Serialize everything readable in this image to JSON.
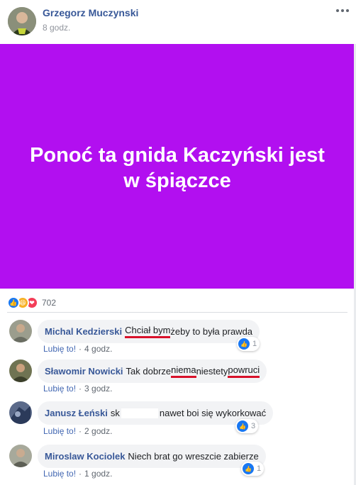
{
  "post": {
    "author": "Grzegorz Muczynski",
    "time": "8 godz.",
    "text": "Ponoć ta gnida Kaczyński jest w śpiączce",
    "bg_color": "#b20ff0",
    "reaction_count": "702",
    "reaction_icons": [
      "like-icon",
      "haha-icon",
      "love-icon"
    ]
  },
  "comments": [
    {
      "author": "Michal Kedzierski",
      "text_part1": "Chciał bym",
      "text_part2": " żeby to była prawda",
      "like_label": "Lubię to!",
      "time": "4 godz.",
      "reactions": "1"
    },
    {
      "author": "Sławomir Nowicki",
      "text_part1": "Tak dobrze ",
      "text_part2": "niema",
      "text_part3": " niestety ",
      "text_part4": "powruci",
      "like_label": "Lubię to!",
      "time": "3 godz."
    },
    {
      "author": "Janusz Łeński",
      "text_part1": "sk",
      "text_part2": " nawet boi się wykorkować",
      "like_label": "Lubię to!",
      "time": "2 godz.",
      "reactions": "3"
    },
    {
      "author": "Miroslaw Kociolek",
      "text_part1": "Niech brat go wreszcie zabierze",
      "like_label": "Lubię to!",
      "time": "1 godz.",
      "reactions": "1"
    }
  ]
}
